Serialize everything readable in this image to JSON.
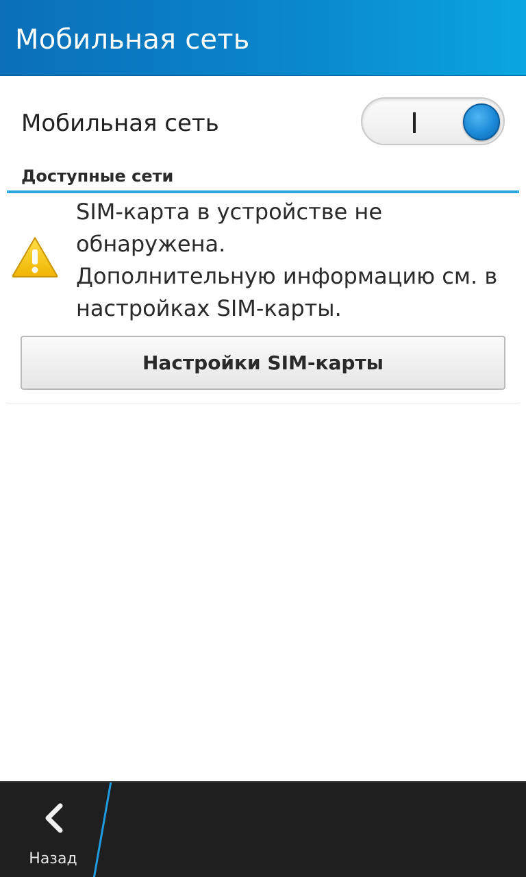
{
  "header": {
    "title": "Мобильная сеть"
  },
  "mobile_network": {
    "label": "Мобильная сеть",
    "toggle_state": "on",
    "toggle_on_mark": "I"
  },
  "available_networks": {
    "section_title": "Доступные сети"
  },
  "warning": {
    "icon": "warning-icon",
    "lines": [
      "SIM-карта в устройстве не",
      "обнаружена.",
      "Дополнительную информацию см. в",
      "настройках SIM-карты."
    ]
  },
  "sim_button": {
    "label": "Настройки SIM-карты"
  },
  "action_bar": {
    "back_label": "Назад",
    "back_icon": "chevron-left-icon"
  },
  "colors": {
    "title_bar": "#0a86cc",
    "accent": "#2aa7df",
    "toggle_knob": "#1d8ad8",
    "warning": "#f3c200",
    "action_bar": "#1f1f1f"
  }
}
